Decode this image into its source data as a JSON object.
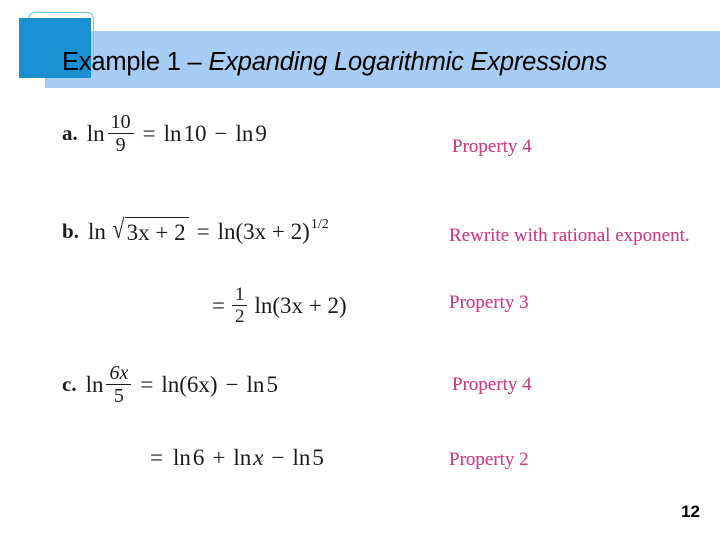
{
  "header": {
    "title_plain": "Example 1 – ",
    "title_italic": "Expanding Logarithmic Expressions",
    "banner_color": "#a8cdf4",
    "square_color": "#1a8fd1",
    "outline_color": "#6ec4ef"
  },
  "body": {
    "label_color": "#cf3f86",
    "lines": [
      {
        "letter": "a.",
        "ln": "ln",
        "numerator": "10",
        "denominator": "9",
        "equals": "=",
        "rhs_ln1": "ln",
        "rhs_val1": "10",
        "minus": "−",
        "rhs_ln2": "ln",
        "rhs_val2": "9",
        "label": "Property 4"
      },
      {
        "letter": "b.",
        "ln": "ln",
        "radicand": "3x + 2",
        "equals": "=",
        "rhs": "ln(3x + 2)",
        "exponent": "1/2",
        "label": "Rewrite with rational exponent."
      },
      {
        "equals": "=",
        "numerator": "1",
        "denominator": "2",
        "rhs": "ln(3x + 2)",
        "label": "Property 3"
      },
      {
        "letter": "c.",
        "ln": "ln",
        "numerator": "6x",
        "denominator": "5",
        "equals": "=",
        "rhs1": "ln(6x)",
        "minus": "−",
        "rhs_ln2": "ln",
        "rhs_val2": "5",
        "label": "Property 4"
      },
      {
        "equals": "=",
        "ln1": "ln",
        "val1": "6",
        "plus": "+",
        "ln2": "ln",
        "val2": "x",
        "minus": "−",
        "ln3": "ln",
        "val3": "5",
        "label": "Property 2"
      }
    ]
  },
  "footer": {
    "page_number": "12"
  }
}
